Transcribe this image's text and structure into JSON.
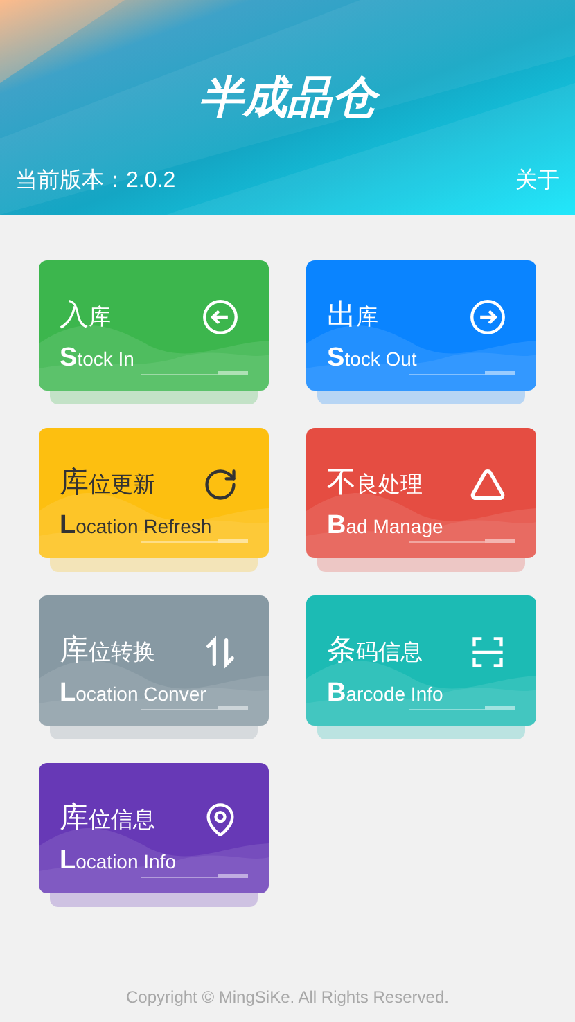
{
  "header": {
    "title": "半成品仓",
    "version": "当前版本：2.0.2",
    "about_link": "关于"
  },
  "cards": [
    {
      "title": "入库",
      "subtitle": "Stock In",
      "color": "#3cb64d",
      "dark_text": false
    },
    {
      "title": "出库",
      "subtitle": "Stock Out",
      "color": "#0a84ff",
      "dark_text": false
    },
    {
      "title": "库位更新",
      "subtitle": "Location Refresh",
      "color": "#fdbf10",
      "dark_text": true
    },
    {
      "title": "不良处理",
      "subtitle": "Bad Manage",
      "color": "#e54d42",
      "dark_text": false
    },
    {
      "title": "库位转换",
      "subtitle": "Location Conver",
      "color": "#8799a3",
      "dark_text": false
    },
    {
      "title": "条码信息",
      "subtitle": "Barcode Info",
      "color": "#1cbbb4",
      "dark_text": false
    },
    {
      "title": "库位信息",
      "subtitle": "Location Info",
      "color": "#6739b6",
      "dark_text": false
    }
  ],
  "footer": "Copyright © MingSiKe. All Rights Reserved."
}
